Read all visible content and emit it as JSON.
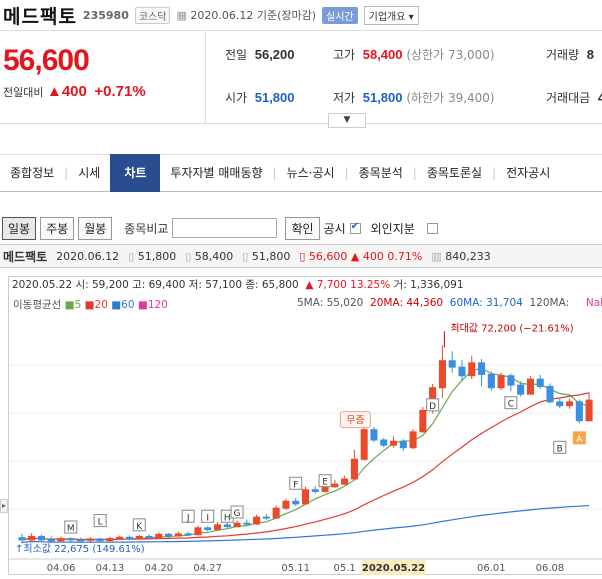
{
  "header": {
    "name": "메드팩토",
    "code": "235980",
    "market": "코스닥",
    "date_label": "2020.06.12 기준(장마감)",
    "live": "실시간",
    "info_btn": "기업개요 ▾"
  },
  "quote": {
    "price": "56,600",
    "change_label": "전일대비",
    "change_abs": "▲400",
    "change_pct": "+0.71%",
    "prev_label": "전일",
    "prev": "56,200",
    "high_label": "고가",
    "high": "58,400",
    "high_limit": "(상한가 73,000)",
    "volume_label": "거래량",
    "volume_frag": "8",
    "open_label": "시가",
    "open": "51,800",
    "low_label": "저가",
    "low": "51,800",
    "low_limit": "(하한가 39,400)",
    "amount_label": "거래대금",
    "amount_frag": "4"
  },
  "tabs": [
    "종합정보",
    "시세",
    "차트",
    "투자자별 매매동향",
    "뉴스·공시",
    "종목분석",
    "종목토론실",
    "전자공시"
  ],
  "toolbar": {
    "daily": "일봉",
    "weekly": "주봉",
    "monthly": "월봉",
    "compare_label": "종목비교",
    "confirm": "확인",
    "disclosure": "공시",
    "foreign": "외인지분"
  },
  "summary": {
    "name": "메드팩토",
    "date": "2020.06.12",
    "open": "51,800",
    "high": "58,400",
    "low": "51,800",
    "close": "56,600",
    "change": "▲ 400",
    "pct": "0.71%",
    "volume": "840,233"
  },
  "chart_info": {
    "date": "2020.05.22",
    "open": "시: 59,200",
    "high": "고: 69,400",
    "low": "저: 57,100",
    "close": "종: 65,800",
    "chg": "▲ 7,700",
    "pct": "13.25%",
    "vol": "거: 1,336,091"
  },
  "ma": {
    "label": "이동평균선",
    "p5": "5",
    "p20": "20",
    "p60": "60",
    "p120": "120",
    "ma5": "5MA: 55,020",
    "ma20": "20MA: 44,360",
    "ma60": "60MA: 31,704",
    "ma120": "120MA:",
    "nan": "NaN"
  },
  "annotations": {
    "max": "최대값 72,200 (−21.61%)",
    "min": "최소값 22,675 (149.61%)",
    "muzeung": "무증",
    "markers": [
      "M",
      "L",
      "K",
      "J",
      "I",
      "H",
      "G",
      "F",
      "E",
      "D",
      "C",
      "B",
      "A"
    ]
  },
  "chart_data": {
    "type": "candlestick",
    "ylim": [
      20000,
      76000
    ],
    "xticks": [
      "04.06",
      "04.13",
      "04.20",
      "04.27",
      "05.11",
      "05.1",
      "2020.05.22",
      "06.01",
      "06.08"
    ],
    "candles": [
      [
        24500,
        24000,
        25500,
        23200
      ],
      [
        24000,
        24800,
        25600,
        23600
      ],
      [
        24800,
        24000,
        25200,
        23600
      ],
      [
        24000,
        23800,
        24800,
        23300
      ],
      [
        23800,
        24300,
        24800,
        23400
      ],
      [
        24300,
        24000,
        24600,
        23600
      ],
      [
        24000,
        23900,
        24500,
        23500
      ],
      [
        23900,
        24200,
        24600,
        23600
      ],
      [
        24200,
        23800,
        24500,
        23400
      ],
      [
        23800,
        24300,
        24700,
        23500
      ],
      [
        24300,
        24600,
        25000,
        24100
      ],
      [
        24600,
        24200,
        25000,
        23900
      ],
      [
        24200,
        24800,
        25200,
        24000
      ],
      [
        24800,
        24500,
        25300,
        24200
      ],
      [
        24500,
        25300,
        25800,
        24300
      ],
      [
        25300,
        24900,
        25600,
        24500
      ],
      [
        24900,
        25400,
        25900,
        24700
      ],
      [
        25400,
        25200,
        25900,
        24900
      ],
      [
        25200,
        26800,
        27300,
        25000
      ],
      [
        26800,
        26400,
        27200,
        26000
      ],
      [
        26400,
        27500,
        28200,
        26200
      ],
      [
        27500,
        27100,
        28000,
        26700
      ],
      [
        27100,
        27900,
        28500,
        26900
      ],
      [
        27900,
        27700,
        28700,
        27300
      ],
      [
        27700,
        29300,
        29900,
        27500
      ],
      [
        29300,
        29100,
        30000,
        28700
      ],
      [
        29100,
        31400,
        32000,
        28900
      ],
      [
        31400,
        33000,
        33600,
        31000
      ],
      [
        33000,
        32400,
        33800,
        31900
      ],
      [
        32400,
        35700,
        36400,
        32200
      ],
      [
        35700,
        35300,
        36500,
        34800
      ],
      [
        35300,
        36400,
        37200,
        35000
      ],
      [
        36400,
        37000,
        38000,
        36100
      ],
      [
        37000,
        38200,
        39000,
        36800
      ],
      [
        38200,
        42800,
        45000,
        38000
      ],
      [
        42800,
        49700,
        51200,
        42500
      ],
      [
        49700,
        47300,
        50300,
        46800
      ],
      [
        47300,
        46100,
        47800,
        45600
      ],
      [
        46100,
        47000,
        48200,
        45500
      ],
      [
        47000,
        45500,
        47500,
        44800
      ],
      [
        45500,
        49200,
        49800,
        45200
      ],
      [
        49200,
        54200,
        55000,
        49000
      ],
      [
        54200,
        59500,
        60400,
        53500
      ],
      [
        59500,
        65800,
        69400,
        57100
      ],
      [
        65800,
        64300,
        68000,
        63000
      ],
      [
        64300,
        62300,
        66000,
        61000
      ],
      [
        62300,
        65300,
        67000,
        61500
      ],
      [
        65300,
        62600,
        66200,
        59800
      ],
      [
        62600,
        59500,
        63300,
        58800
      ],
      [
        59500,
        62300,
        63000,
        59000
      ],
      [
        62300,
        60100,
        62800,
        58700
      ],
      [
        60100,
        58000,
        61000,
        57400
      ],
      [
        58000,
        61500,
        62200,
        57800
      ],
      [
        61500,
        59800,
        62500,
        59200
      ],
      [
        59800,
        56200,
        60500,
        55900
      ],
      [
        56200,
        55300,
        57200,
        54700
      ],
      [
        55300,
        56200,
        57000,
        54600
      ],
      [
        56200,
        51800,
        56700,
        51200
      ],
      [
        51800,
        56600,
        58400,
        51800
      ]
    ],
    "series": [
      {
        "name": "5",
        "color": "#6aa84f"
      },
      {
        "name": "20",
        "color": "#e23a2e"
      },
      {
        "name": "60",
        "color": "#2f78d4"
      },
      {
        "name": "120",
        "color": "#e0399a"
      }
    ]
  }
}
